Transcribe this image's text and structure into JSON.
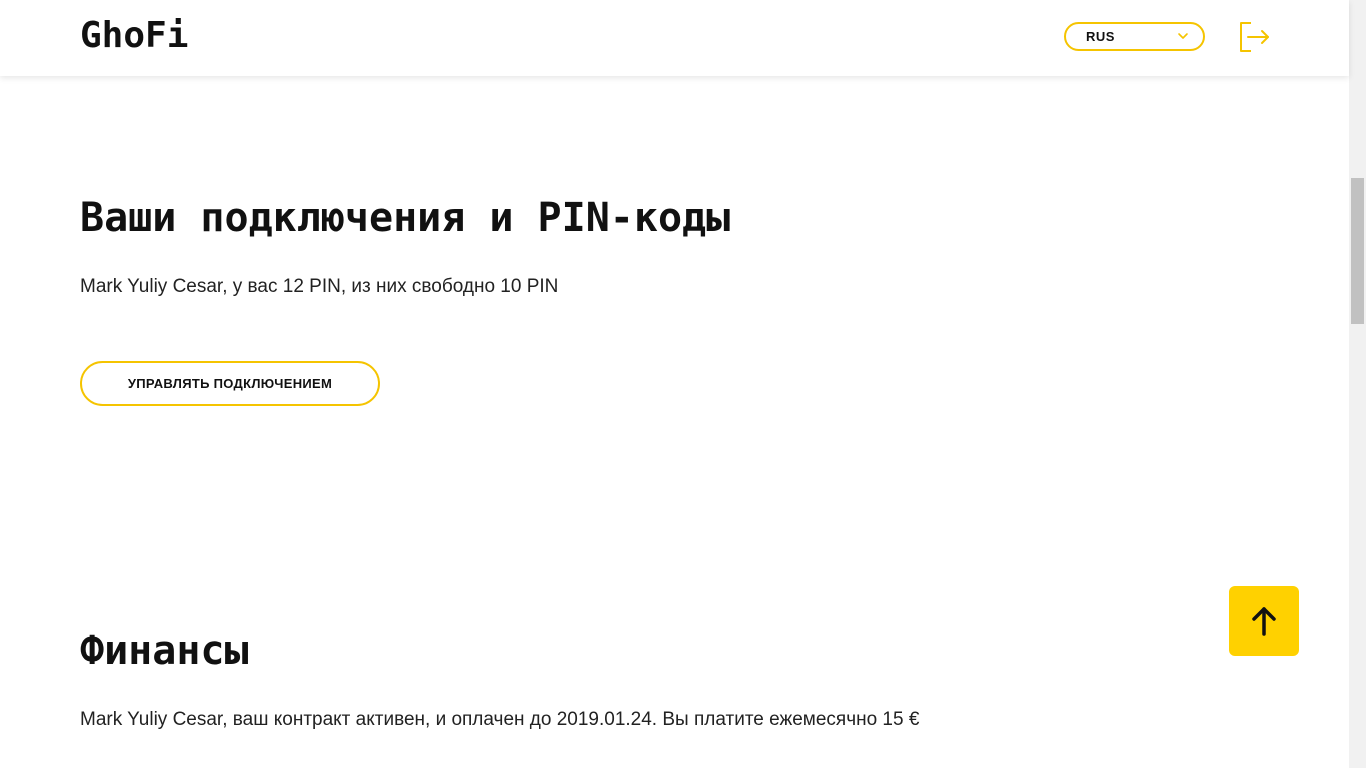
{
  "header": {
    "logo": "GhoFi",
    "language": {
      "selected": "RUS"
    },
    "logout_icon": "logout-arrow-icon"
  },
  "connections": {
    "title": "Ваши подключения и PIN-коды",
    "summary": "Mark Yuliy Cesar, у вас 12 PIN, из них свободно 10 PIN",
    "manage_button": "УПРАВЛЯТЬ ПОДКЛЮЧЕНИЕМ"
  },
  "finances": {
    "title": "Финансы",
    "summary": "Mark Yuliy Cesar, ваш контракт активен, и оплачен до 2019.01.24. Вы платите ежемесячно 15 €"
  },
  "scroll_top": {
    "icon": "arrow-up-icon"
  },
  "colors": {
    "accent": "#f5c400",
    "accent_fill": "#ffd100",
    "text": "#111111"
  }
}
